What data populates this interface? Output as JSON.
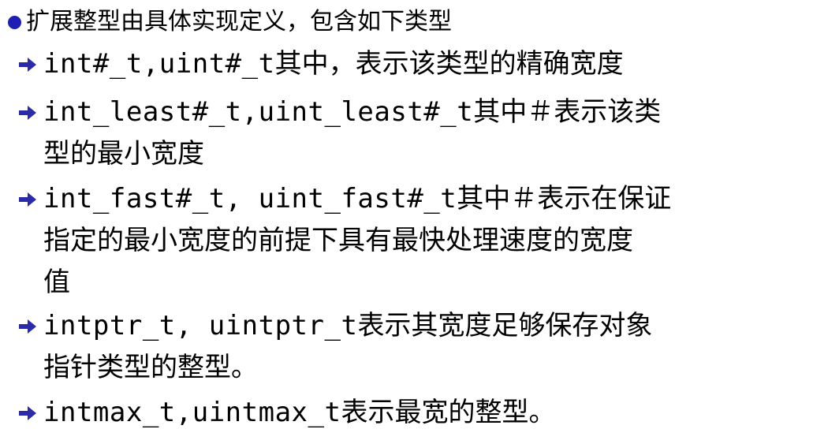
{
  "heading": {
    "text": "扩展整型由具体实现定义，包含如下类型"
  },
  "items": [
    {
      "lines": [
        {
          "code": "int#_t,uint#_t",
          "text": "其中，表示该类型的精确宽度"
        }
      ]
    },
    {
      "lines": [
        {
          "code": "int_least#_t,uint_least#_t",
          "text": "其中＃表示该类"
        },
        {
          "code": "",
          "text": "型的最小宽度"
        }
      ]
    },
    {
      "lines": [
        {
          "code": "int_fast#_t, uint_fast#_t",
          "text": "其中＃表示在保证"
        },
        {
          "code": "",
          "text": "指定的最小宽度的前提下具有最快处理速度的宽度"
        },
        {
          "code": "",
          "text": "值"
        }
      ]
    },
    {
      "lines": [
        {
          "code": "intptr_t, uintptr_t",
          "text": "表示其宽度足够保存对象"
        },
        {
          "code": "",
          "text": "指针类型的整型。"
        }
      ]
    },
    {
      "lines": [
        {
          "code": "intmax_t,uintmax_t",
          "text": "表示最宽的整型。"
        }
      ]
    }
  ],
  "colors": {
    "bullet": "#1f1fb4",
    "arrow": "#2b2ba8",
    "text": "#000000"
  },
  "icons": {
    "heading_bullet": "filled-circle",
    "item_bullet": "right-arrow"
  }
}
